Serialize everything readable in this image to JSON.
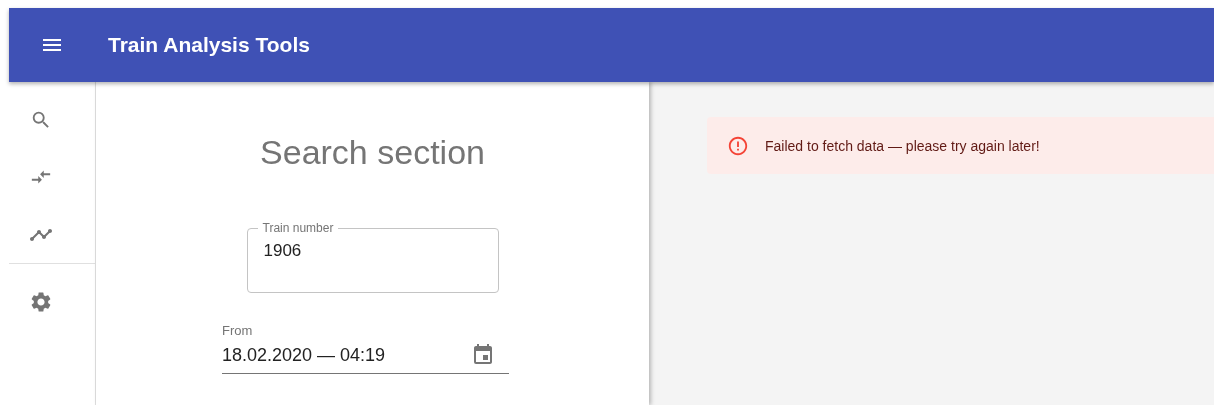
{
  "app_bar": {
    "title": "Train Analysis Tools"
  },
  "sidebar": {
    "items": [
      {
        "kind": "search"
      },
      {
        "kind": "compare"
      },
      {
        "kind": "timeline"
      },
      {
        "kind": "divider"
      },
      {
        "kind": "settings"
      }
    ]
  },
  "search_section": {
    "heading": "Search section",
    "fields": [
      {
        "kind": "outlined",
        "label": "Train number",
        "value": "1906"
      },
      {
        "kind": "date",
        "label": "From",
        "value": "18.02.2020 — 04:19"
      }
    ]
  },
  "alert": {
    "message": "Failed to fetch data — please try again later!"
  }
}
